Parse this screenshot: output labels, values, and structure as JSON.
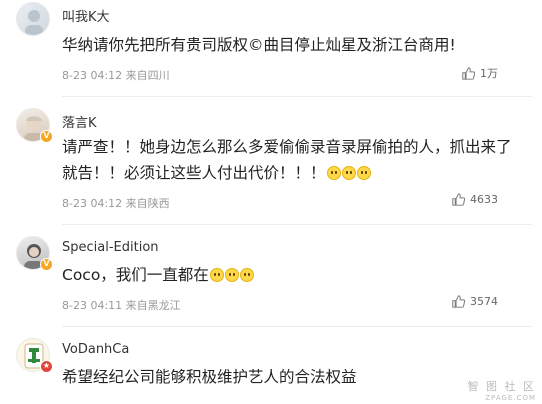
{
  "comments": [
    {
      "username": "叫我K大",
      "text": "华纳请你先把所有贵司版权©曲目停止灿星及浙江台商用!",
      "date": "8-23 04:12",
      "location": "来自四川",
      "likes": "1万",
      "emoji_count": 0,
      "badge": ""
    },
    {
      "username": "落言K",
      "text": "请严查！！她身边怎么那么多爱偷偷录音录屏偷拍的人，抓出来了就告！！必须让这些人付出代价！！！",
      "date": "8-23 04:12",
      "location": "来自陕西",
      "likes": "4633",
      "emoji_count": 3,
      "badge": "V"
    },
    {
      "username": "Special-Edition",
      "text": "Coco，我们一直都在",
      "date": "8-23 04:11",
      "location": "来自黑龙江",
      "likes": "3574",
      "emoji_count": 3,
      "badge": "V"
    },
    {
      "username": "VoDanhCa",
      "text": "希望经纪公司能够积极维护艺人的合法权益",
      "date": "",
      "location": "",
      "likes": "",
      "emoji_count": 0,
      "badge": "★"
    }
  ],
  "watermark": {
    "line1": "智 图 社 区",
    "line2": "ZPAGE.COM"
  },
  "colors": {
    "badge_orange": "#f5a623",
    "badge_red": "#e0453c",
    "meta_gray": "#999999"
  }
}
